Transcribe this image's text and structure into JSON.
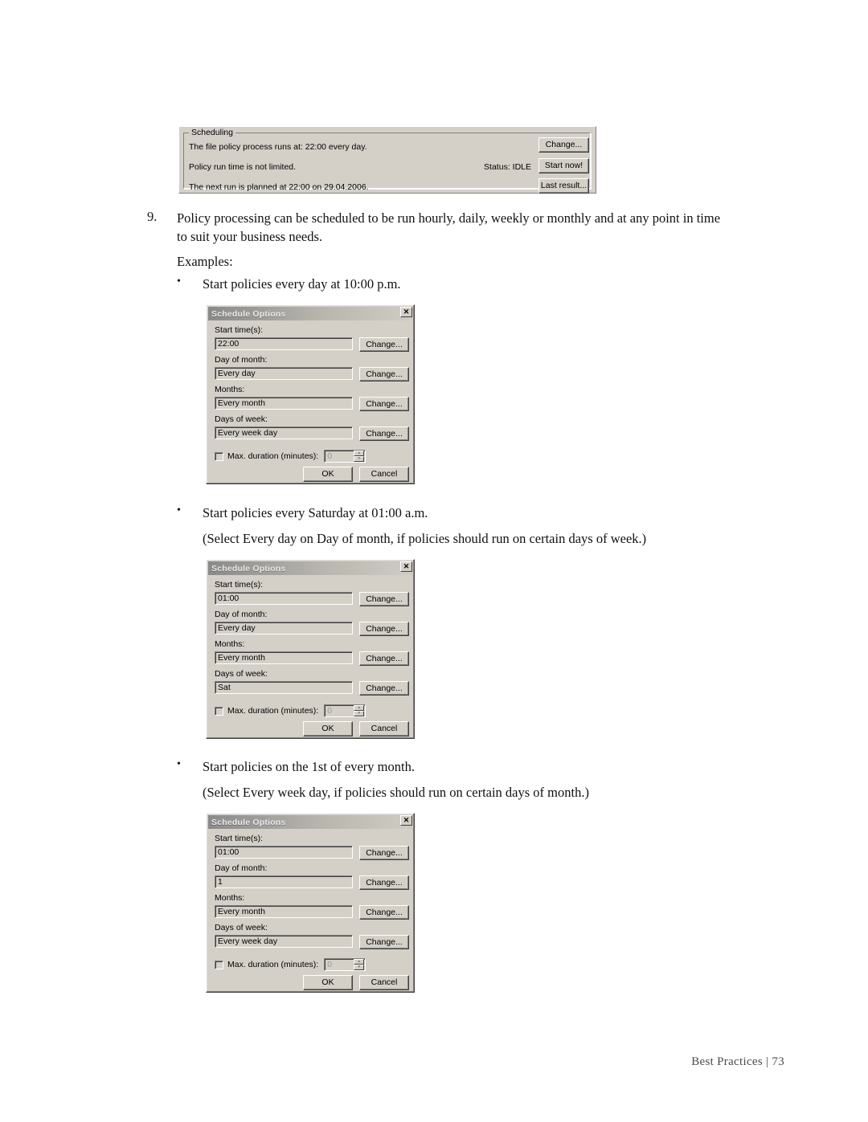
{
  "scheduling_panel": {
    "legend": "Scheduling",
    "line1": "The file policy process runs at: 22:00 every day.",
    "line2": "Policy run time is not limited.",
    "line3": "The next run is planned at 22:00 on 29.04.2006.",
    "status": "Status: IDLE",
    "buttons": {
      "change": "Change...",
      "start_now": "Start now!",
      "last_result": "Last result..."
    }
  },
  "document": {
    "item_number": "9.",
    "item_text_line1": "Policy processing can be scheduled to be run hourly, daily, weekly or monthly and at any point in time",
    "item_text_line2": "to suit your business needs.",
    "examples_label": "Examples:",
    "bullet_char": "•",
    "bullet1": "Start policies every day at 10:00 p.m.",
    "bullet2": "Start policies every Saturday at 01:00 a.m.",
    "note2": "(Select Every day on Day of month, if policies should run on certain days of week.)",
    "bullet3": "Start policies on the 1st of every month.",
    "note3": "(Select Every week day, if policies should run on certain days of month.)",
    "footer": "Best Practices | 73"
  },
  "dialog_common": {
    "title": "Schedule Options",
    "close_glyph": "✕",
    "labels": {
      "start_time": "Start time(s):",
      "day_of_month": "Day of month:",
      "months": "Months:",
      "days_of_week": "Days of week:",
      "max_duration": "Max. duration (minutes):"
    },
    "change_label": "Change...",
    "ok_label": "OK",
    "cancel_label": "Cancel",
    "spinner_value": "0",
    "spin_up": "▲",
    "spin_down": "▼"
  },
  "dialogs": [
    {
      "start_time": "22:00",
      "day_of_month": "Every day",
      "months": "Every month",
      "days_of_week": "Every week day"
    },
    {
      "start_time": "01:00",
      "day_of_month": "Every day",
      "months": "Every month",
      "days_of_week": "Sat"
    },
    {
      "start_time": "01:00",
      "day_of_month": "1",
      "months": "Every month",
      "days_of_week": "Every week day"
    }
  ],
  "colors": {
    "dialog_face": "#d4d0c8",
    "page_background": "#ffffff",
    "text": "#000000"
  }
}
